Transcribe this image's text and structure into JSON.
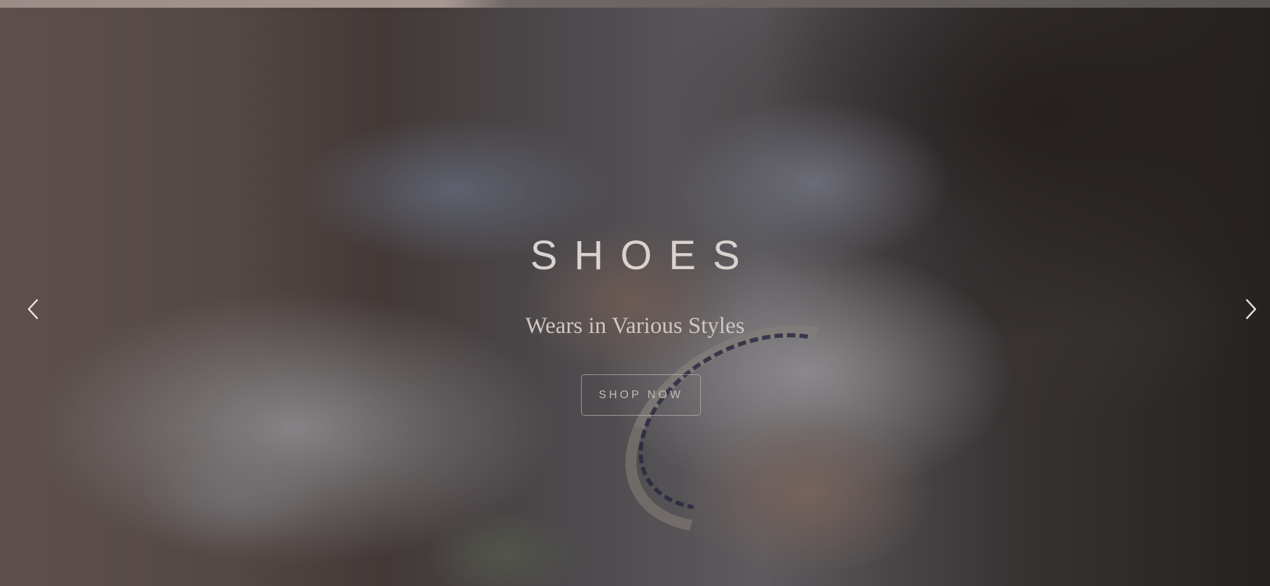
{
  "hero": {
    "title": "SHOES",
    "subtitle": "Wears in Various Styles",
    "cta_label": "SHOP NOW",
    "prev_icon": "chevron-left-icon",
    "next_icon": "chevron-right-icon"
  },
  "colors": {
    "text": "#d9d2ce",
    "overlay": "rgba(30,26,26,0.42)"
  }
}
